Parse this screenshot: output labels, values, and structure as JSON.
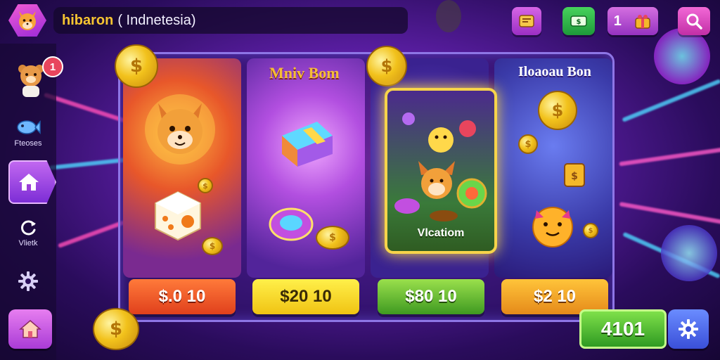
{
  "header": {
    "brand": "hibaron",
    "region": "( Indnetesia)",
    "gift_count": "1"
  },
  "sidebar": {
    "notification_count": "1",
    "items": [
      {
        "label": "Fteoses",
        "icon": "fish-icon"
      },
      {
        "label": "",
        "icon": "home-icon"
      },
      {
        "label": "Vlietk",
        "icon": "refresh-icon"
      },
      {
        "label": "",
        "icon": "gear-icon"
      },
      {
        "label": "",
        "icon": "home-icon"
      }
    ]
  },
  "panel": {
    "headings": [
      "Mniv Bom",
      "Iloaoau Bon"
    ],
    "featured_label": "Vlcatiom",
    "offers": [
      {
        "price": "$.0 10",
        "color": "#e0401c"
      },
      {
        "price": "$20 10",
        "color": "#f0c313"
      },
      {
        "price": "$80 10",
        "color": "#3f9a21"
      },
      {
        "price": "$2 10",
        "color": "#e58a1a"
      }
    ]
  },
  "footer": {
    "score": "4101"
  },
  "colors": {
    "accent": "#9b2ad8",
    "gold": "#f5bd35",
    "panel_border": "#8e76e6"
  }
}
